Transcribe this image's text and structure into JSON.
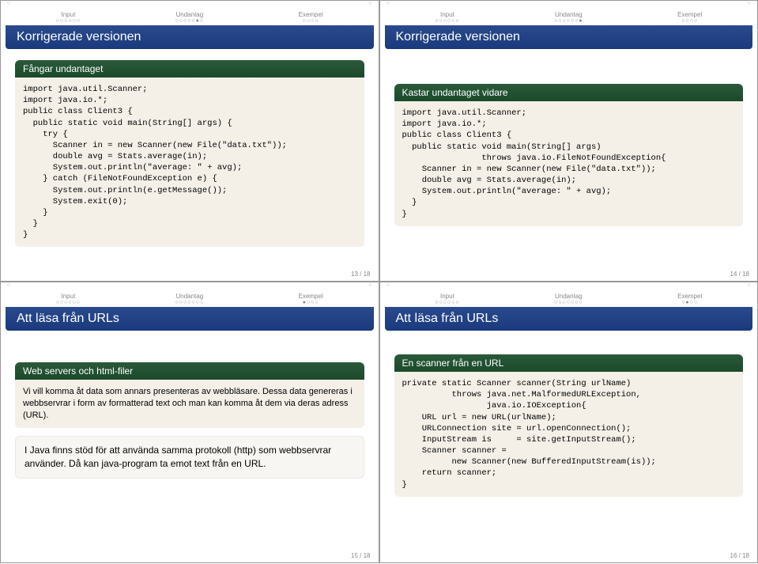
{
  "nav": {
    "input": "Input",
    "undantag": "Undantag",
    "exempel": "Exempel"
  },
  "s1": {
    "title": "Korrigerade versionen",
    "boxhead": "Fångar undantaget",
    "code": "import java.util.Scanner;\nimport java.io.*;\npublic class Client3 {\n  public static void main(String[] args) {\n    try {\n      Scanner in = new Scanner(new File(\"data.txt\"));\n      double avg = Stats.average(in);\n      System.out.println(\"average: \" + avg);\n    } catch (FileNotFoundException e) {\n      System.out.println(e.getMessage());\n      System.exit(0);\n    }\n  }\n}",
    "page": "13 / 18"
  },
  "s2": {
    "title": "Korrigerade versionen",
    "boxhead": "Kastar undantaget vidare",
    "code": "import java.util.Scanner;\nimport java.io.*;\npublic class Client3 {\n  public static void main(String[] args)\n                throws java.io.FileNotFoundException{\n    Scanner in = new Scanner(new File(\"data.txt\"));\n    double avg = Stats.average(in);\n    System.out.println(\"average: \" + avg);\n  }\n}",
    "page": "14 / 18"
  },
  "s3": {
    "title": "Att läsa från URLs",
    "boxhead": "Web servers och html-filer",
    "boxtext": "Vi vill komma åt data som annars presenteras av webbläsare. Dessa data genereras i webbservrar i form av formatterad text och man kan komma åt dem via deras adress (URL).",
    "para": "I Java finns stöd för att använda samma protokoll (http) som webbservrar använder. Då kan java-program ta emot text från en URL.",
    "page": "15 / 18"
  },
  "s4": {
    "title": "Att läsa från URLs",
    "boxhead": "En scanner från en URL",
    "code": "private static Scanner scanner(String urlName)\n          throws java.net.MalformedURLException,\n                 java.io.IOException{\n    URL url = new URL(urlName);\n    URLConnection site = url.openConnection();\n    InputStream is     = site.getInputStream();\n    Scanner scanner =\n          new Scanner(new BufferedInputStream(is));\n    return scanner;\n}",
    "page": "16 / 18"
  }
}
